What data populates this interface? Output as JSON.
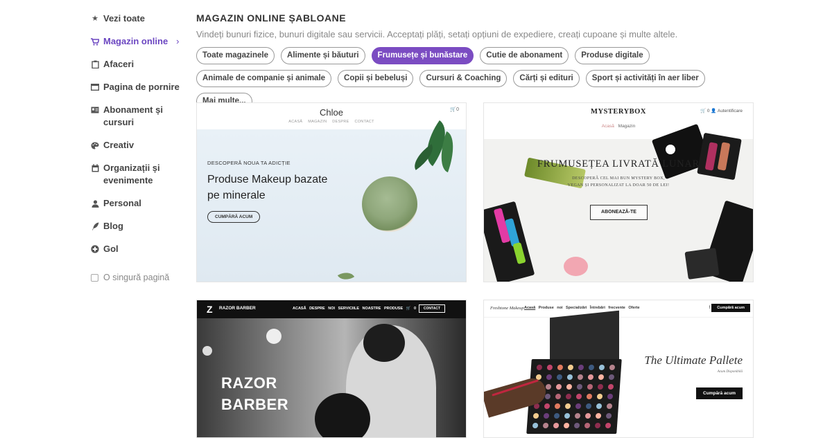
{
  "sidebar": {
    "items": [
      {
        "label": "Vezi toate",
        "icon": "star-icon"
      },
      {
        "label": "Magazin online",
        "icon": "cart-icon",
        "active": true
      },
      {
        "label": "Afaceri",
        "icon": "clipboard-icon"
      },
      {
        "label": "Pagina de pornire",
        "icon": "browser-window-icon"
      },
      {
        "label": "Abonament și cursuri",
        "icon": "id-card-icon"
      },
      {
        "label": "Creativ",
        "icon": "palette-icon"
      },
      {
        "label": "Organizații și evenimente",
        "icon": "calendar-icon"
      },
      {
        "label": "Personal",
        "icon": "user-icon"
      },
      {
        "label": "Blog",
        "icon": "quill-icon"
      },
      {
        "label": "Gol",
        "icon": "plus-circle-icon"
      }
    ],
    "single_page_label": "O singură pagină"
  },
  "main": {
    "title": "MAGAZIN ONLINE ȘABLOANE",
    "subtitle": "Vindeți bunuri fizice, bunuri digitale sau servicii. Acceptați plăți, setați opțiuni de expediere, creați cupoane și multe altele.",
    "filters": [
      {
        "label": "Toate magazinele"
      },
      {
        "label": "Alimente și băuturi"
      },
      {
        "label": "Frumusețe și bunăstare",
        "active": true
      },
      {
        "label": "Cutie de abonament"
      },
      {
        "label": "Produse digitale"
      },
      {
        "label": "Animale de companie și animale"
      },
      {
        "label": "Copii și bebeluși"
      },
      {
        "label": "Cursuri & Coaching"
      },
      {
        "label": "Cărți și edituri"
      },
      {
        "label": "Sport și activități în aer liber"
      },
      {
        "label": "Mai multe..."
      }
    ]
  },
  "templates": {
    "chloe": {
      "logo": "Chloe",
      "nav": "ACASĂ  MAGAZIN  DESPRE  CONTACT",
      "cart": "🛒0",
      "eyebrow": "DESCOPERĂ NOUA TA ADICȚIE",
      "headline": "Produse Makeup bazate pe minerale",
      "cta": "CUMPĂRĂ ACUM"
    },
    "mysterybox": {
      "logo": "MYSTERYBOX",
      "nav_right": "🛒 0   👤 Autentificare",
      "nav_home": "Acasă",
      "nav_shop": "Magazin",
      "headline": "FRUMUSEȚEA LIVRATĂ LUNAR",
      "sub1": "DESCOPERĂ CEL MAI BUN MYSTERY BOX,",
      "sub2": "VEGAN ȘI PERSONALIZAT LA DOAR 50 DE LEI!",
      "cta": "ABONEAZĂ-TE"
    },
    "razor": {
      "brand": "RAZOR BARBER",
      "nav": "ACASĂ  DESPRE NOI  SERVICIILE NOASTRE  PRODUSE  🛒 0",
      "contact": "CONTACT",
      "line1": "RAZOR",
      "line2": "BARBER"
    },
    "freshtone": {
      "logo": "Freshtone Makeup",
      "nav_home": "Acasă",
      "nav_rest": "Produse noi  Specializări  Întrebări frecvente  Oferte",
      "social": "f ▾",
      "buy": "Cumpără acum",
      "headline": "The Ultimate Pallete",
      "available": "Acum Disponibilă",
      "cta": "Cumpără acum"
    }
  },
  "colors": {
    "accent": "#7b4cc2"
  }
}
